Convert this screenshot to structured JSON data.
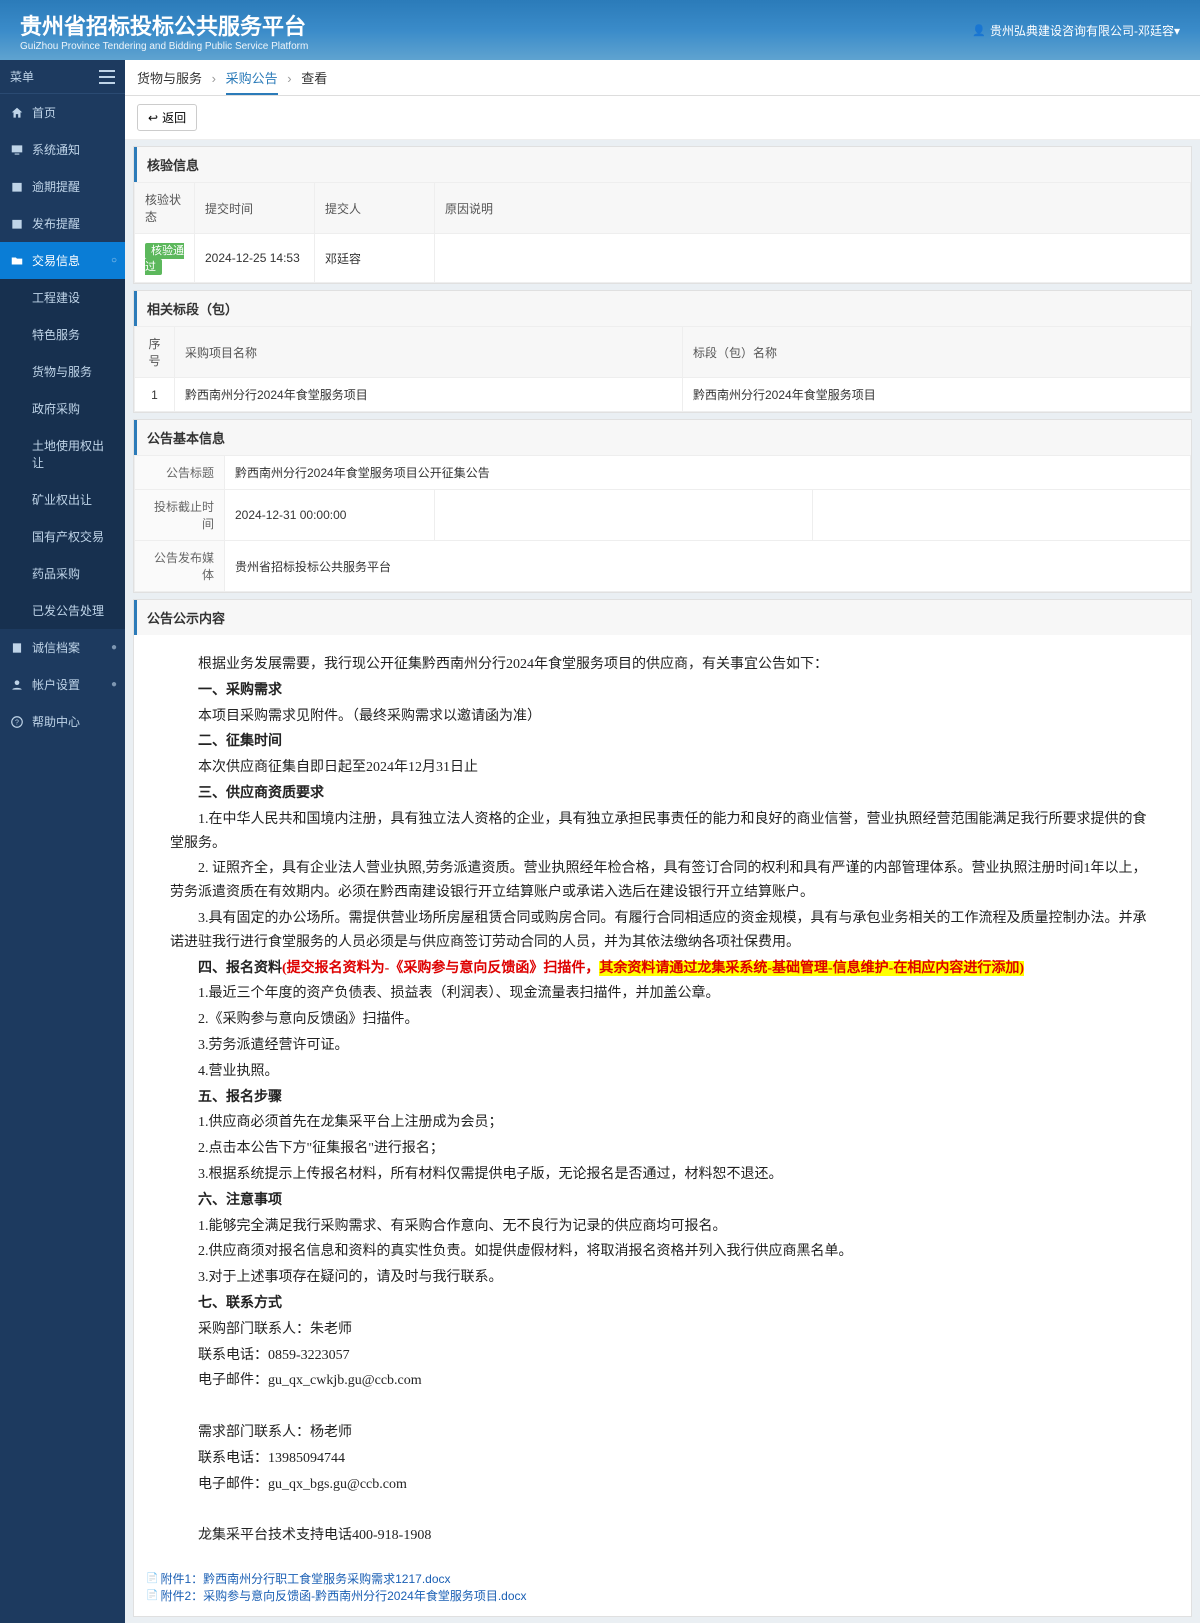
{
  "header": {
    "title": "贵州省招标投标公共服务平台",
    "subtitle": "GuiZhou Province Tendering and Bidding Public Service Platform",
    "user": "贵州弘典建设咨询有限公司-邓廷容▾"
  },
  "sidebar": {
    "menu_label": "菜单",
    "items": [
      {
        "label": "首页",
        "icon": "home"
      },
      {
        "label": "系统通知",
        "icon": "monitor"
      },
      {
        "label": "逾期提醒",
        "icon": "calendar"
      },
      {
        "label": "发布提醒",
        "icon": "calendar"
      },
      {
        "label": "交易信息",
        "icon": "folder",
        "active": true,
        "expand": "○"
      },
      {
        "label": "诚信档案",
        "icon": "book",
        "expand": "●"
      },
      {
        "label": "帐户设置",
        "icon": "user",
        "expand": "●"
      },
      {
        "label": "帮助中心",
        "icon": "help"
      }
    ],
    "sub_items": [
      "工程建设",
      "特色服务",
      "货物与服务",
      "政府采购",
      "土地使用权出让",
      "矿业权出让",
      "国有产权交易",
      "药品采购",
      "已发公告处理"
    ]
  },
  "breadcrumb": [
    "货物与服务",
    "采购公告",
    "查看"
  ],
  "toolbar": {
    "back": "返回"
  },
  "verification": {
    "title": "核验信息",
    "headers": [
      "核验状态",
      "提交时间",
      "提交人",
      "原因说明"
    ],
    "row": {
      "status": "核验通过",
      "time": "2024-12-25 14:53",
      "submitter": "邓廷容",
      "reason": ""
    }
  },
  "lots": {
    "title": "相关标段（包）",
    "headers": [
      "序号",
      "采购项目名称",
      "标段（包）名称"
    ],
    "rows": [
      {
        "idx": "1",
        "project": "黔西南州分行2024年食堂服务项目",
        "lot": "黔西南州分行2024年食堂服务项目"
      }
    ]
  },
  "basic": {
    "title": "公告基本信息",
    "labels": {
      "subject": "公告标题",
      "deadline": "投标截止时间",
      "media": "公告发布媒体"
    },
    "subject": "黔西南州分行2024年食堂服务项目公开征集公告",
    "deadline": "2024-12-31 00:00:00",
    "media": "贵州省招标投标公共服务平台"
  },
  "announcement": {
    "title": "公告公示内容",
    "intro": "根据业务发展需要，我行现公开征集黔西南州分行2024年食堂服务项目的供应商，有关事宜公告如下：",
    "sec1_title": "一、采购需求",
    "sec1_body": "本项目采购需求见附件。（最终采购需求以邀请函为准）",
    "sec2_title": "二、征集时间",
    "sec2_body": "本次供应商征集自即日起至2024年12月31日止",
    "sec3_title": "三、供应商资质要求",
    "sec3_1": "1.在中华人民共和国境内注册，具有独立法人资格的企业，具有独立承担民事责任的能力和良好的商业信誉，营业执照经营范围能满足我行所要求提供的食堂服务。",
    "sec3_2": "2. 证照齐全，具有企业法人营业执照,劳务派遣资质。营业执照经年检合格，具有签订合同的权利和具有严谨的内部管理体系。营业执照注册时间1年以上，劳务派遣资质在有效期内。必须在黔西南建设银行开立结算账户或承诺入选后在建设银行开立结算账户。",
    "sec3_3": "3.具有固定的办公场所。需提供营业场所房屋租赁合同或购房合同。有履行合同相适应的资金规模，具有与承包业务相关的工作流程及质量控制办法。并承诺进驻我行进行食堂服务的人员必须是与供应商签订劳动合同的人员，并为其依法缴纳各项社保费用。",
    "sec4_title": "四、报名资料",
    "sec4_red": "(提交报名资料为-《采购参与意向反馈函》扫描件，",
    "sec4_hl": "其余资料请通过龙集采系统-基础管理-信息维护-在相应内容进行添加)",
    "sec4_1": "1.最近三个年度的资产负债表、损益表（利润表）、现金流量表扫描件，并加盖公章。",
    "sec4_2": "2.《采购参与意向反馈函》扫描件。",
    "sec4_3": "3.劳务派遣经营许可证。",
    "sec4_4": "4.营业执照。",
    "sec5_title": "五、报名步骤",
    "sec5_1": "1.供应商必须首先在龙集采平台上注册成为会员；",
    "sec5_2": "2.点击本公告下方\"征集报名\"进行报名；",
    "sec5_3": "3.根据系统提示上传报名材料，所有材料仅需提供电子版，无论报名是否通过，材料恕不退还。",
    "sec6_title": "六、注意事项",
    "sec6_1": "1.能够完全满足我行采购需求、有采购合作意向、无不良行为记录的供应商均可报名。",
    "sec6_2": "2.供应商须对报名信息和资料的真实性负责。如提供虚假材料，将取消报名资格并列入我行供应商黑名单。",
    "sec6_3": "3.对于上述事项存在疑问的，请及时与我行联系。",
    "sec7_title": "七、联系方式",
    "sec7_1": "采购部门联系人：朱老师",
    "sec7_2": "联系电话：0859-3223057",
    "sec7_3": "电子邮件：gu_qx_cwkjb.gu@ccb.com",
    "sec7_4": "需求部门联系人：杨老师",
    "sec7_5": "联系电话：13985094744",
    "sec7_6": "电子邮件：gu_qx_bgs.gu@ccb.com",
    "support": "龙集采平台技术支持电话400-918-1908"
  },
  "attachments": [
    "附件1：黔西南州分行职工食堂服务采购需求1217.docx",
    "附件2：采购参与意向反馈函-黔西南州分行2024年食堂服务项目.docx"
  ]
}
